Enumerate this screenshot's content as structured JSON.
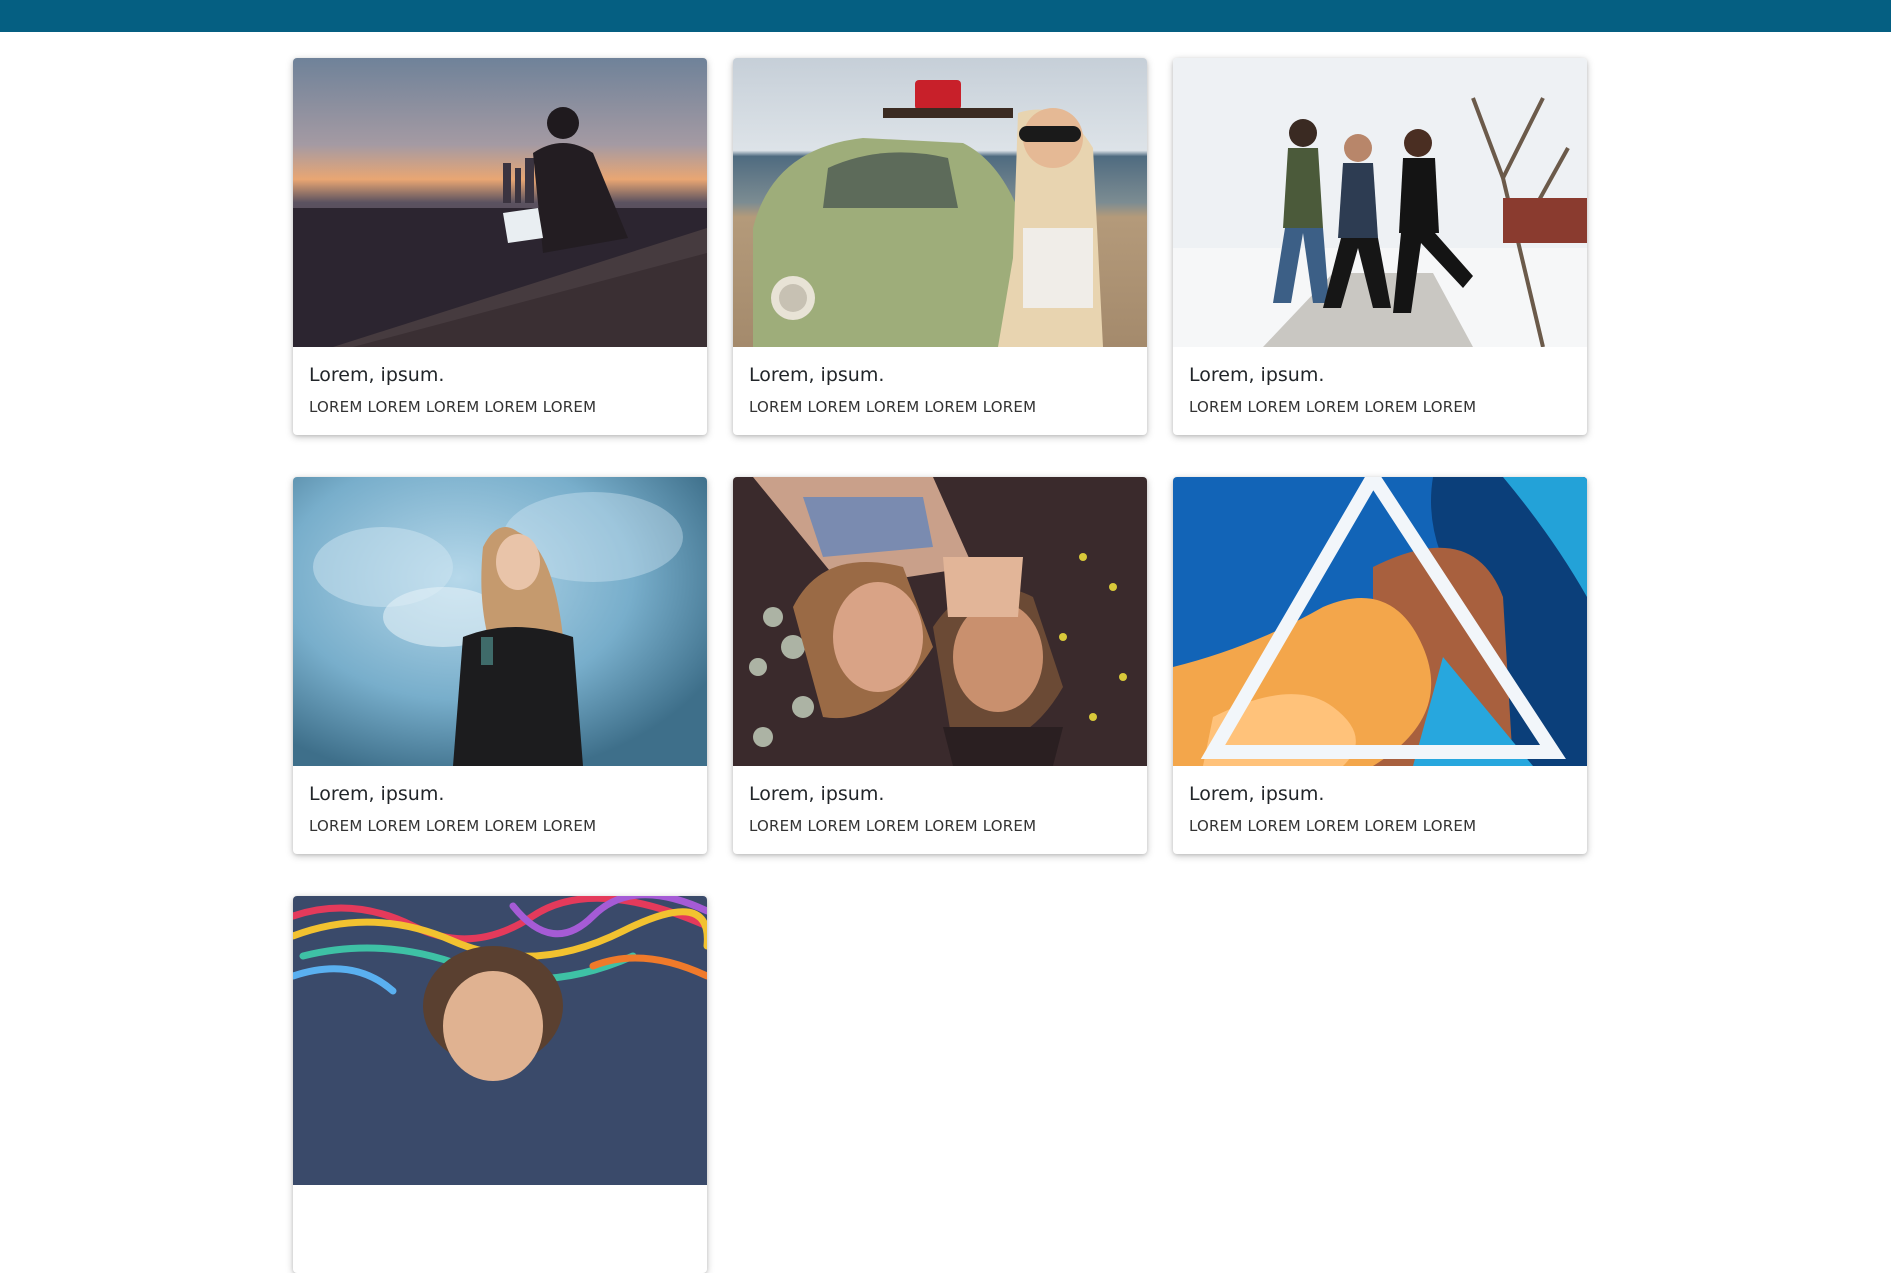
{
  "header": {
    "color": "#055f82"
  },
  "cards": [
    {
      "title": "Lorem, ipsum.",
      "text": "LOREM LOREM LOREM LOREM LOREM",
      "image": "man-laptop-city-sunset-image"
    },
    {
      "title": "Lorem, ipsum.",
      "text": "LOREM LOREM LOREM LOREM LOREM",
      "image": "woman-vintage-car-beach-image"
    },
    {
      "title": "Lorem, ipsum.",
      "text": "LOREM LOREM LOREM LOREM LOREM",
      "image": "friends-jumping-snow-image"
    },
    {
      "title": "Lorem, ipsum.",
      "text": "LOREM LOREM LOREM LOREM LOREM",
      "image": "woman-blue-smoke-image"
    },
    {
      "title": "Lorem, ipsum.",
      "text": "LOREM LOREM LOREM LOREM LOREM",
      "image": "two-women-covering-eyes-image"
    },
    {
      "title": "Lorem, ipsum.",
      "text": "LOREM LOREM LOREM LOREM LOREM",
      "image": "triangle-mural-image"
    },
    {
      "title": "",
      "text": "",
      "image": "colorful-graffiti-portrait-image"
    }
  ]
}
